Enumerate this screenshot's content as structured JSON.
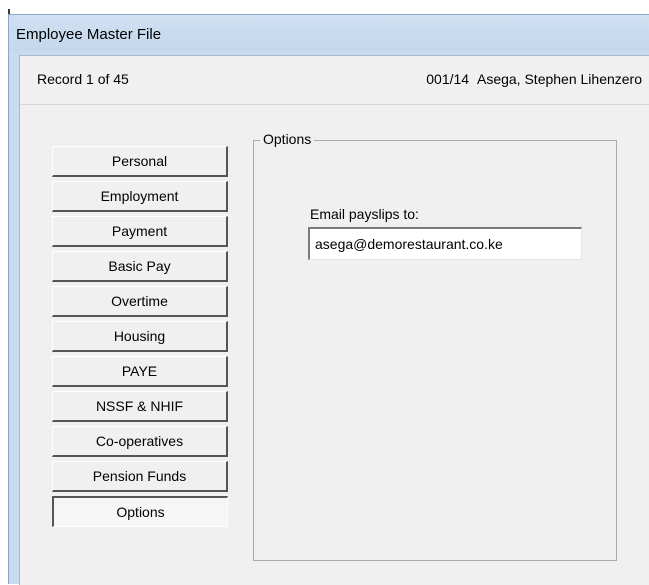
{
  "window": {
    "title": "Employee Master File"
  },
  "record_bar": {
    "position_text": "Record 1 of 45",
    "employee_code": "001/14",
    "employee_name": "Asega, Stephen Lihenzero"
  },
  "nav": {
    "items": [
      {
        "label": "Personal",
        "active": false
      },
      {
        "label": "Employment",
        "active": false
      },
      {
        "label": "Payment",
        "active": false
      },
      {
        "label": "Basic Pay",
        "active": false
      },
      {
        "label": "Overtime",
        "active": false
      },
      {
        "label": "Housing",
        "active": false
      },
      {
        "label": "PAYE",
        "active": false
      },
      {
        "label": "NSSF & NHIF",
        "active": false
      },
      {
        "label": "Co-operatives",
        "active": false
      },
      {
        "label": "Pension Funds",
        "active": false
      },
      {
        "label": "Options",
        "active": true
      }
    ]
  },
  "options_panel": {
    "group_title": "Options",
    "email_label": "Email payslips to:",
    "email_value": "asega@demorestaurant.co.ke"
  },
  "colors": {
    "frame": "#c9dcef",
    "client_bg": "#f0f0f0",
    "button_shadow": "#555555"
  }
}
